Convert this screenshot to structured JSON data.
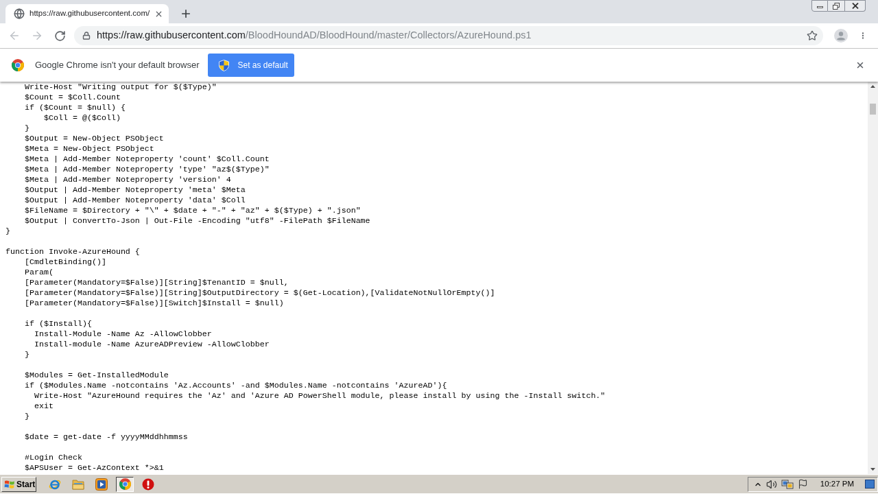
{
  "browser_tabs": [
    {
      "title": "https://raw.githubusercontent.com/",
      "selected": true
    }
  ],
  "toolbar": {
    "back": {
      "disabled": true
    },
    "forward": {
      "disabled": true
    },
    "url_host": "https://raw.githubusercontent.com",
    "url_path": "/BloodHoundAD/BloodHound/master/Collectors/AzureHound.ps1"
  },
  "infobar": {
    "message": "Google Chrome isn't your default browser",
    "button": "Set as default"
  },
  "code_lines": [
    {
      "kind": "code",
      "text": "    Write-Host \"Writing output for $($Type)\""
    },
    {
      "kind": "code",
      "text": "    $Count = $Coll.Count"
    },
    {
      "kind": "code",
      "text": "    if ($Count = $null) {"
    },
    {
      "kind": "code",
      "text": "        $Coll = @($Coll)"
    },
    {
      "kind": "code",
      "text": "    }"
    },
    {
      "kind": "code",
      "text": "    $Output = New-Object PSObject"
    },
    {
      "kind": "code",
      "text": "    $Meta = New-Object PSObject"
    },
    {
      "kind": "code",
      "text": "    $Meta | Add-Member Noteproperty 'count' $Coll.Count"
    },
    {
      "kind": "code",
      "text": "    $Meta | Add-Member Noteproperty 'type' \"az$($Type)\""
    },
    {
      "kind": "code",
      "text": "    $Meta | Add-Member Noteproperty 'version' 4"
    },
    {
      "kind": "code",
      "text": "    $Output | Add-Member Noteproperty 'meta' $Meta"
    },
    {
      "kind": "code",
      "text": "    $Output | Add-Member Noteproperty 'data' $Coll"
    },
    {
      "kind": "code",
      "text": "    $FileName = $Directory + \"\\\" + $date + \"-\" + \"az\" + $($Type) + \".json\""
    },
    {
      "kind": "code",
      "text": "    $Output | ConvertTo-Json | Out-File -Encoding \"utf8\" -FilePath $FileName"
    },
    {
      "kind": "code",
      "text": "}"
    },
    {
      "kind": "blank"
    },
    {
      "kind": "code",
      "text": "function Invoke-AzureHound {"
    },
    {
      "kind": "code",
      "text": "    [CmdletBinding()]"
    },
    {
      "kind": "code",
      "text": "    Param("
    },
    {
      "kind": "code",
      "text": "    [Parameter(Mandatory=$False)][String]$TenantID = $null,"
    },
    {
      "kind": "code",
      "text": "    [Parameter(Mandatory=$False)][String]$OutputDirectory = $(Get-Location),[ValidateNotNullOrEmpty()]"
    },
    {
      "kind": "code",
      "text": "    [Parameter(Mandatory=$False)][Switch]$Install = $null)"
    },
    {
      "kind": "blank"
    },
    {
      "kind": "code",
      "text": "    if ($Install){"
    },
    {
      "kind": "code",
      "text": "      Install-Module -Name Az -AllowClobber"
    },
    {
      "kind": "code",
      "text": "      Install-module -Name AzureADPreview -AllowClobber"
    },
    {
      "kind": "code",
      "text": "    }"
    },
    {
      "kind": "blank"
    },
    {
      "kind": "code",
      "text": "    $Modules = Get-InstalledModule"
    },
    {
      "kind": "code",
      "text": "    if ($Modules.Name -notcontains 'Az.Accounts' -and $Modules.Name -notcontains 'AzureAD'){"
    },
    {
      "kind": "code",
      "text": "      Write-Host \"AzureHound requires the 'Az' and 'Azure AD PowerShell module, please install by using the -Install switch.\""
    },
    {
      "kind": "code",
      "text": "      exit"
    },
    {
      "kind": "code",
      "text": "    }"
    },
    {
      "kind": "blank"
    },
    {
      "kind": "code",
      "text": "    $date = get-date -f yyyyMMddhhmmss"
    },
    {
      "kind": "blank"
    },
    {
      "kind": "code",
      "text": "    #Login Check"
    },
    {
      "kind": "code",
      "text": "    $APSUser = Get-AzContext *>&1"
    }
  ],
  "taskbar": {
    "start": "Start",
    "apps": [
      {
        "kind": "ie",
        "selected": false
      },
      {
        "kind": "folder",
        "selected": false
      },
      {
        "kind": "media",
        "selected": false
      },
      {
        "kind": "chrome",
        "selected": true
      },
      {
        "kind": "alert",
        "selected": false
      }
    ],
    "clock": "10:27 PM"
  }
}
